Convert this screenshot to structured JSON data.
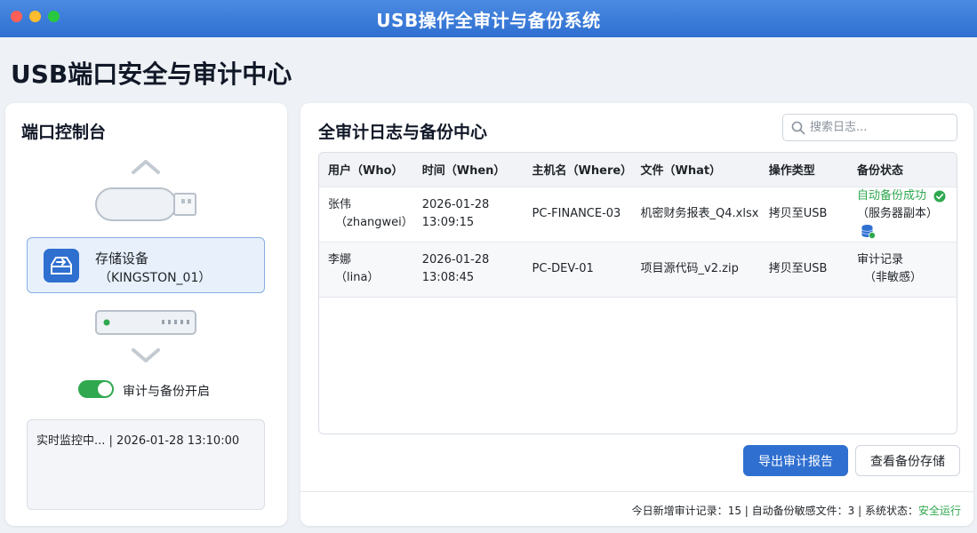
{
  "window": {
    "title": "USB操作全审计与备份系统"
  },
  "page": {
    "title": "USB端口安全与审计中心"
  },
  "port_console": {
    "title": "端口控制台",
    "device_name": "存储设备",
    "device_id": "（KINGSTON_01）",
    "toggle_label": "审计与备份开启",
    "toggle_on": true,
    "monitor_text": "实时监控中... | 2026-01-28 13:10:00"
  },
  "audit": {
    "title": "全审计日志与备份中心",
    "search_placeholder": "搜索日志...",
    "columns": [
      "用户（Who）",
      "时间（When）",
      "主机名（Where）",
      "文件（What）",
      "操作类型",
      "备份状态"
    ],
    "rows": [
      {
        "user": "张伟",
        "user_id": "（zhangwei）",
        "date": "2026-01-28",
        "time": "13:09:15",
        "host": "PC-FINANCE-03",
        "file": "机密财务报表_Q4.xlsx",
        "op": "拷贝至USB",
        "status": "自动备份成功",
        "status_sub": "（服务器副本）"
      },
      {
        "user": "李娜",
        "user_id": "（lina）",
        "date": "2026-01-28",
        "time": "13:08:45",
        "host": "PC-DEV-01",
        "file": "项目源代码_v2.zip",
        "op": "拷贝至USB",
        "status": "审计记录",
        "status_sub": "（非敏感）"
      }
    ],
    "export_button": "导出审计报告",
    "view_backup_button": "查看备份存储"
  },
  "footer": {
    "new_records_label": "今日新增审计记录：",
    "new_records": "15",
    "sep1": " | ",
    "auto_backup_label": "自动备份敏感文件：",
    "auto_backup": "3",
    "sep2": " | ",
    "system_status_label": "系统状态：",
    "system_status": "安全运行"
  },
  "colors": {
    "accent": "#2f6fd0",
    "success": "#2fa84f"
  }
}
